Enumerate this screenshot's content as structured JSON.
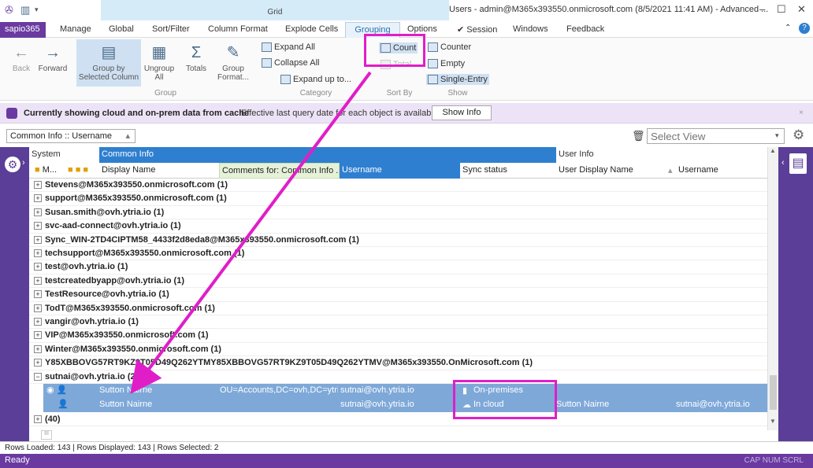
{
  "window": {
    "title": "Users - admin@M365x393550.onmicrosoft.com (8/5/2021 11:41 AM) - Advanced ...",
    "context_tab": "Grid"
  },
  "menu": {
    "items": [
      "sapio365",
      "Manage",
      "Global",
      "Sort/Filter",
      "Column Format",
      "Explode Cells",
      "Grouping",
      "Options",
      "Session",
      "Windows",
      "Feedback"
    ]
  },
  "ribbon": {
    "back": "Back",
    "forward": "Forward",
    "group_by": "Group by Selected Column",
    "ungroup": "Ungroup All",
    "totals": "Totals",
    "group_format": "Group Format...",
    "group_label": "Group",
    "expand_all": "Expand All",
    "collapse_all": "Collapse All",
    "expand_up_to": "Expand up to...",
    "category_label": "Category",
    "count": "Count",
    "total": "Total",
    "sortby_label": "Sort By",
    "counter": "Counter",
    "empty": "Empty",
    "single_entry": "Single-Entry",
    "show_label": "Show"
  },
  "infobar": {
    "message": "Currently showing cloud and on-prem data from cache",
    "effective": "Effective last query date for each object is available.",
    "show_info": "Show Info"
  },
  "filter": {
    "group_column": "Common Info :: Username",
    "select_view_placeholder": "Select View"
  },
  "grid": {
    "header_groups": {
      "system": "System",
      "common": "Common Info",
      "user": "User Info"
    },
    "columns": {
      "m": "M...",
      "display_name": "Display Name",
      "comments": "Comments for: Common Info ...",
      "username": "Username",
      "sync_status": "Sync status",
      "user_display_name": "User Display Name",
      "username2": "Username"
    },
    "groups": [
      "Stevens@M365x393550.onmicrosoft.com (1)",
      "support@M365x393550.onmicrosoft.com (1)",
      "Susan.smith@ovh.ytria.io (1)",
      "svc-aad-connect@ovh.ytria.io (1)",
      "Sync_WIN-2TD4CIPTM58_4433f2d8eda8@M365x393550.onmicrosoft.com (1)",
      "techsupport@M365x393550.onmicrosoft.com (1)",
      "test@ovh.ytria.io (1)",
      "testcreatedbyapp@ovh.ytria.io (1)",
      "TestResource@ovh.ytria.io (1)",
      "TodT@M365x393550.onmicrosoft.com (1)",
      "vangir@ovh.ytria.io (1)",
      "VIP@M365x393550.onmicrosoft.com (1)",
      "Winter@M365x393550.onmicrosoft.com (1)",
      "Y85XBBOVG57RT9KZ9T05D49Q262YTMY85XBBOVG57RT9KZ9T05D49Q262YTMV@M365x393550.OnMicrosoft.com (1)",
      "sutnai@ovh.ytria.io (2)"
    ],
    "rows": [
      {
        "display_name": "Sutton Nairne",
        "comments": "OU=Accounts,DC=ovh,DC=ytria",
        "username": "sutnai@ovh.ytria.io",
        "sync_status": "On-premises",
        "user_display_name": "",
        "username2": ""
      },
      {
        "display_name": "Sutton Nairne",
        "comments": "",
        "username": "sutnai@ovh.ytria.io",
        "sync_status": "In cloud",
        "user_display_name": "Sutton Nairne",
        "username2": "sutnai@ovh.ytria.io"
      }
    ],
    "empty_group": "(40)"
  },
  "status": {
    "counts": "Rows Loaded: 143  |  Rows Displayed: 143  |  Rows Selected: 2",
    "ready": "Ready",
    "indicators": "CAP  NUM  SCRL"
  },
  "colors": {
    "accent": "#6a3aa0",
    "highlight": "#e01ec8",
    "selected_row": "#7ea8d8",
    "header_blue": "#2f7fd0"
  }
}
